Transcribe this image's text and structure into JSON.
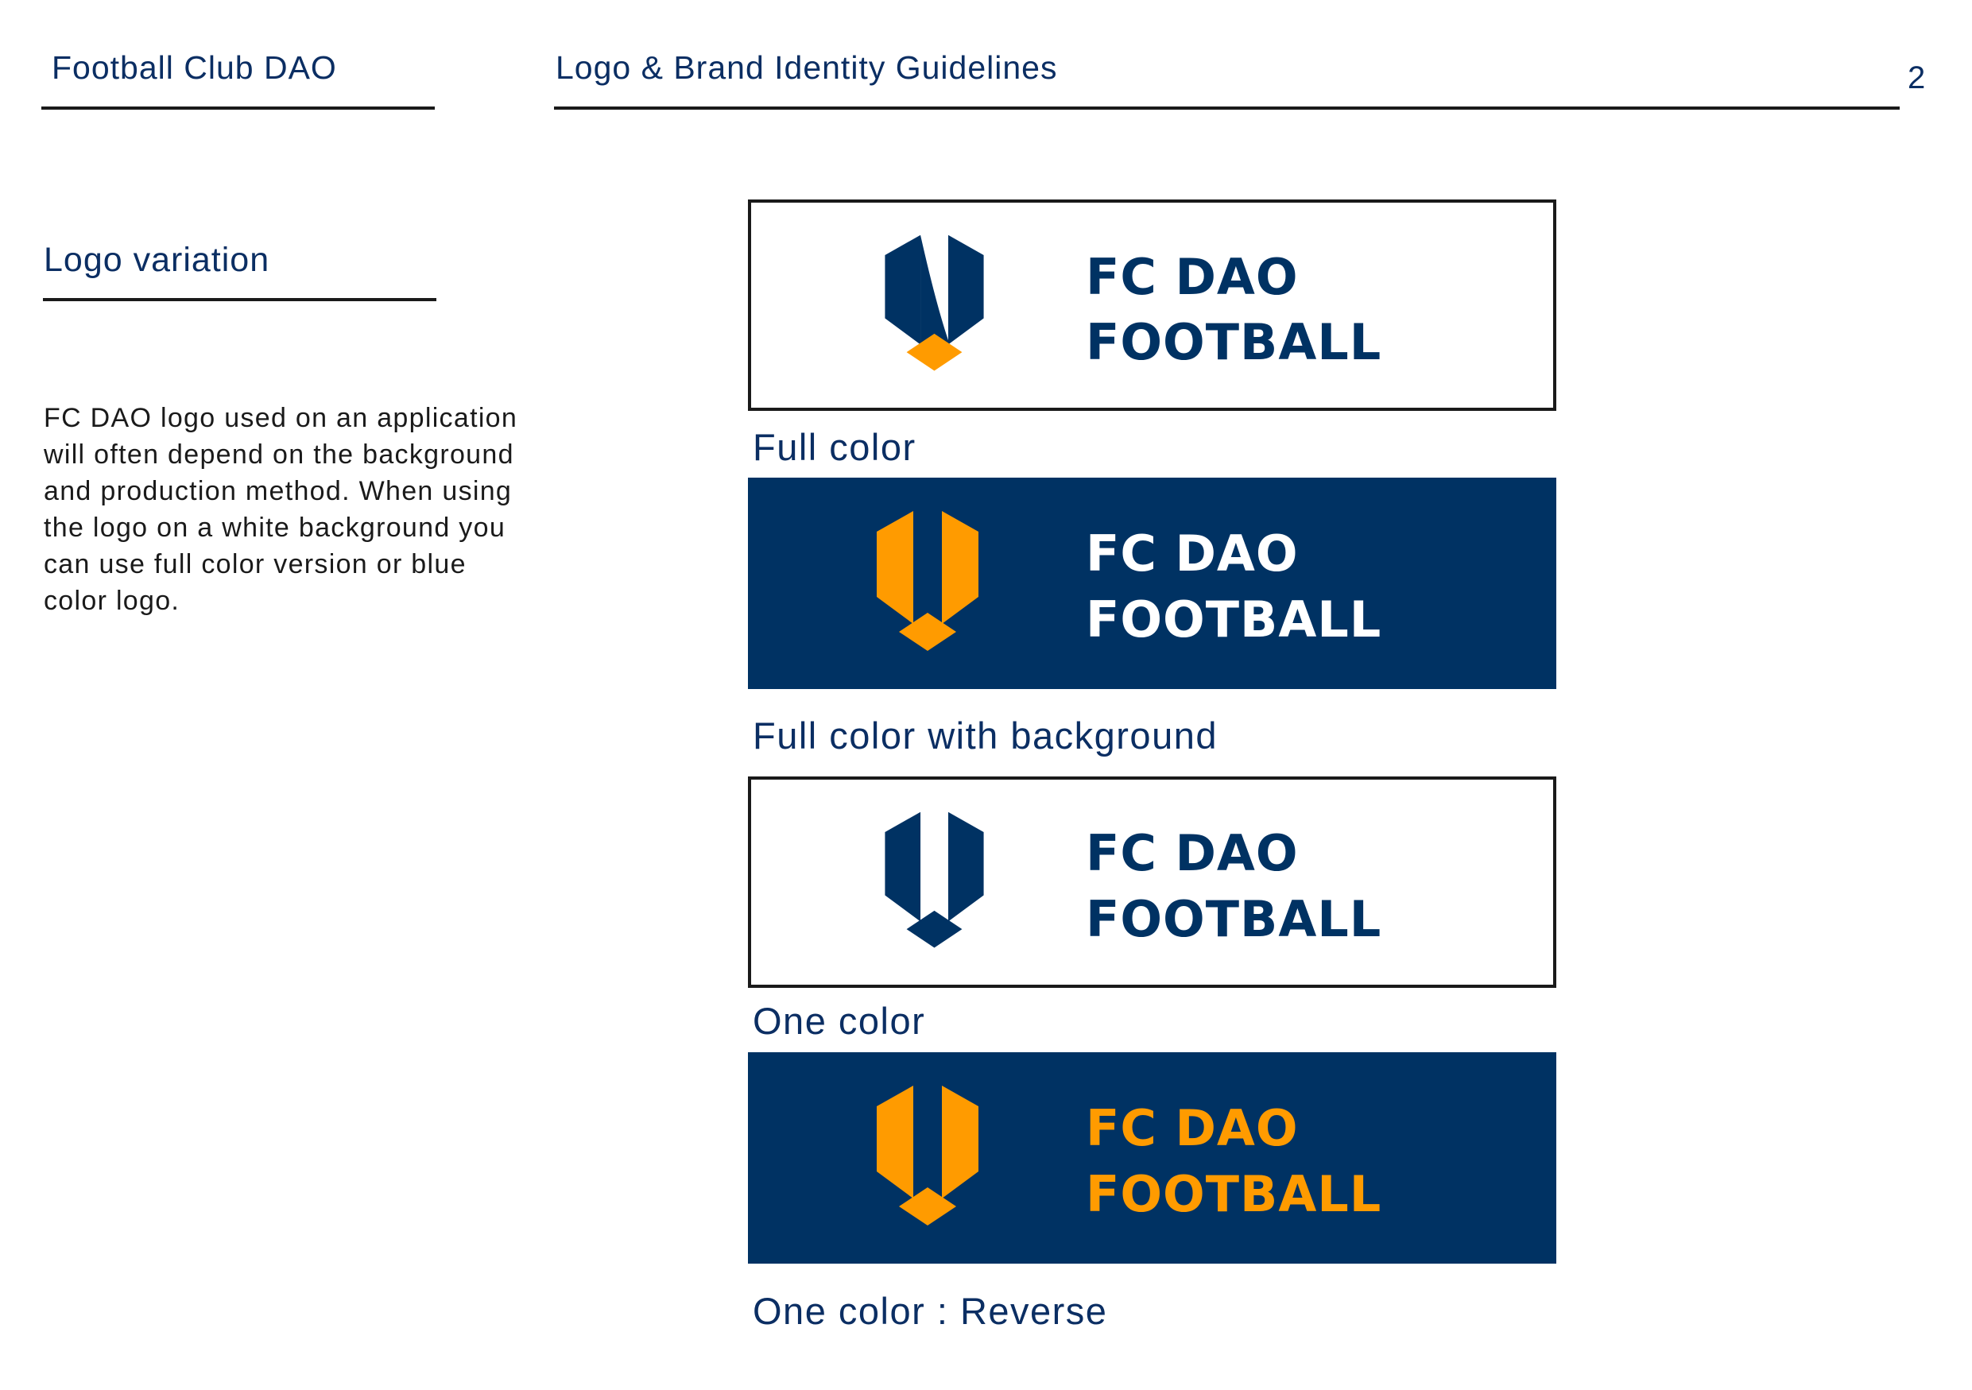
{
  "header": {
    "club_name": "Football Club DAO",
    "doc_title": "Logo & Brand Identity Guidelines",
    "page_number": "2"
  },
  "section": {
    "title": "Logo variation",
    "description": "FC DAO logo used on an application will often depend on the background and production method. When using the logo on a white background you can use full color version or blue color logo."
  },
  "colors": {
    "navy": "#003263",
    "orange": "#FF9B00",
    "white": "#FFFFFF"
  },
  "variations": [
    {
      "caption": "Full color",
      "line1": "FC DAO",
      "line2": "FOOTBALL"
    },
    {
      "caption": "Full color with background",
      "line1": "FC DAO",
      "line2": "FOOTBALL"
    },
    {
      "caption": "One color",
      "line1": "FC DAO",
      "line2": "FOOTBALL"
    },
    {
      "caption": "One color : Reverse",
      "line1": "FC DAO",
      "line2": "FOOTBALL"
    }
  ]
}
